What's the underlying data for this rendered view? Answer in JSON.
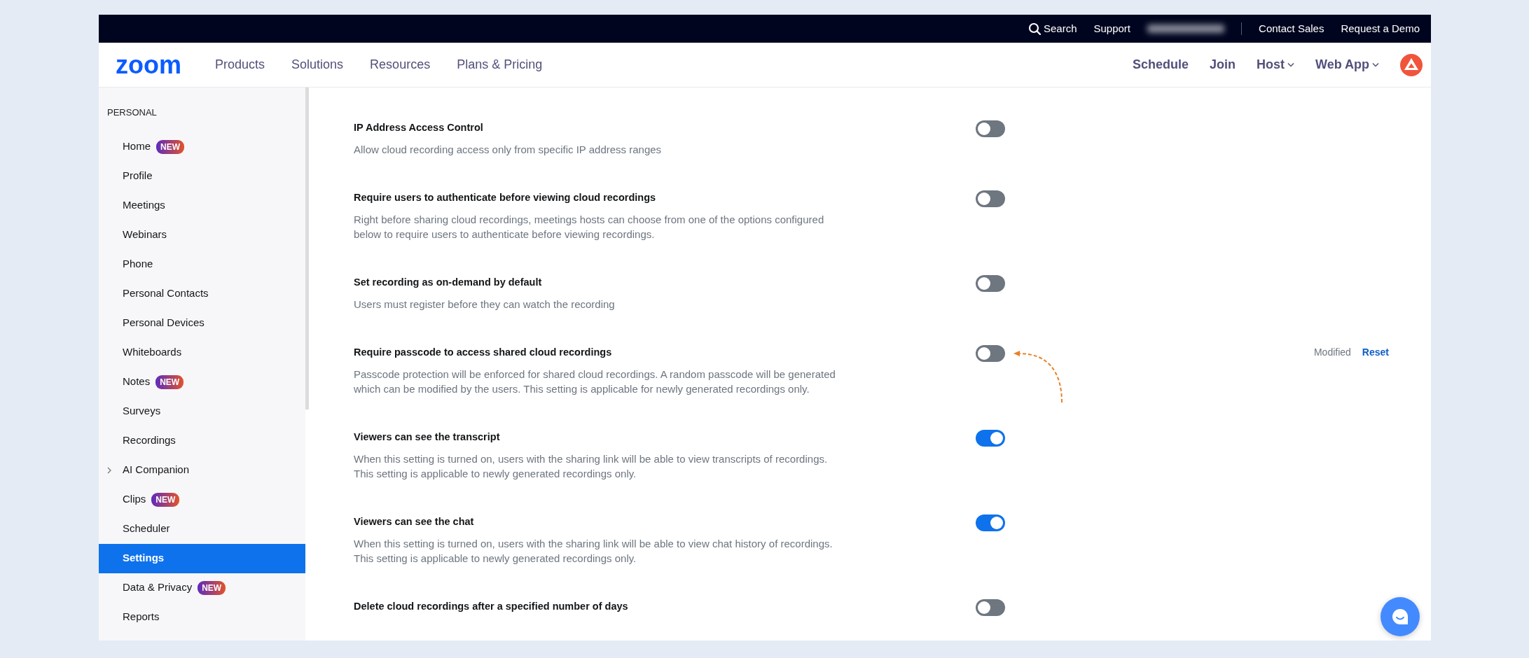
{
  "top_bar": {
    "search": "Search",
    "links": [
      "Support",
      "Contact Sales",
      "Request a Demo"
    ]
  },
  "navbar": {
    "logo": "zoom",
    "menu": [
      "Products",
      "Solutions",
      "Resources",
      "Plans & Pricing"
    ],
    "actions": [
      {
        "label": "Schedule",
        "dropdown": false
      },
      {
        "label": "Join",
        "dropdown": false
      },
      {
        "label": "Host",
        "dropdown": true
      },
      {
        "label": "Web App",
        "dropdown": true
      }
    ]
  },
  "sidebar": {
    "section": "PERSONAL",
    "items": [
      {
        "label": "Home",
        "badge": "NEW",
        "selected": false,
        "expandable": false
      },
      {
        "label": "Profile",
        "selected": false,
        "expandable": false
      },
      {
        "label": "Meetings",
        "selected": false,
        "expandable": false
      },
      {
        "label": "Webinars",
        "selected": false,
        "expandable": false
      },
      {
        "label": "Phone",
        "selected": false,
        "expandable": false
      },
      {
        "label": "Personal Contacts",
        "selected": false,
        "expandable": false
      },
      {
        "label": "Personal Devices",
        "selected": false,
        "expandable": false
      },
      {
        "label": "Whiteboards",
        "selected": false,
        "expandable": false
      },
      {
        "label": "Notes",
        "badge": "NEW",
        "selected": false,
        "expandable": false
      },
      {
        "label": "Surveys",
        "selected": false,
        "expandable": false
      },
      {
        "label": "Recordings",
        "selected": false,
        "expandable": false
      },
      {
        "label": "AI Companion",
        "selected": false,
        "expandable": true
      },
      {
        "label": "Clips",
        "badge": "NEW",
        "selected": false,
        "expandable": false
      },
      {
        "label": "Scheduler",
        "selected": false,
        "expandable": false
      },
      {
        "label": "Settings",
        "selected": true,
        "expandable": false
      },
      {
        "label": "Data & Privacy",
        "badge": "NEW",
        "selected": false,
        "expandable": false
      },
      {
        "label": "Reports",
        "selected": false,
        "expandable": false
      }
    ]
  },
  "settings": [
    {
      "title": "IP Address Access Control",
      "description": "Allow cloud recording access only from specific IP address ranges",
      "on": false
    },
    {
      "title": "Require users to authenticate before viewing cloud recordings",
      "description": "Right before sharing cloud recordings, meetings hosts can choose from one of the options configured below to require users to authenticate before viewing recordings.",
      "on": false
    },
    {
      "title": "Set recording as on-demand by default",
      "description": "Users must register before they can watch the recording",
      "on": false
    },
    {
      "title": "Require passcode to access shared cloud recordings",
      "description": "Passcode protection will be enforced for shared cloud recordings. A random passcode will be generated which can be modified by the users. This setting is applicable for newly generated recordings only.",
      "on": false,
      "status": "Modified",
      "action": "Reset",
      "annotated": true
    },
    {
      "title": "Viewers can see the transcript",
      "description": "When this setting is turned on, users with the sharing link will be able to view transcripts of recordings. This setting is applicable to newly generated recordings only.",
      "on": true
    },
    {
      "title": "Viewers can see the chat",
      "description": "When this setting is turned on, users with the sharing link will be able to view chat history of recordings. This setting is applicable to newly generated recordings only.",
      "on": true
    },
    {
      "title": "Delete cloud recordings after a specified number of days",
      "on": false
    }
  ]
}
